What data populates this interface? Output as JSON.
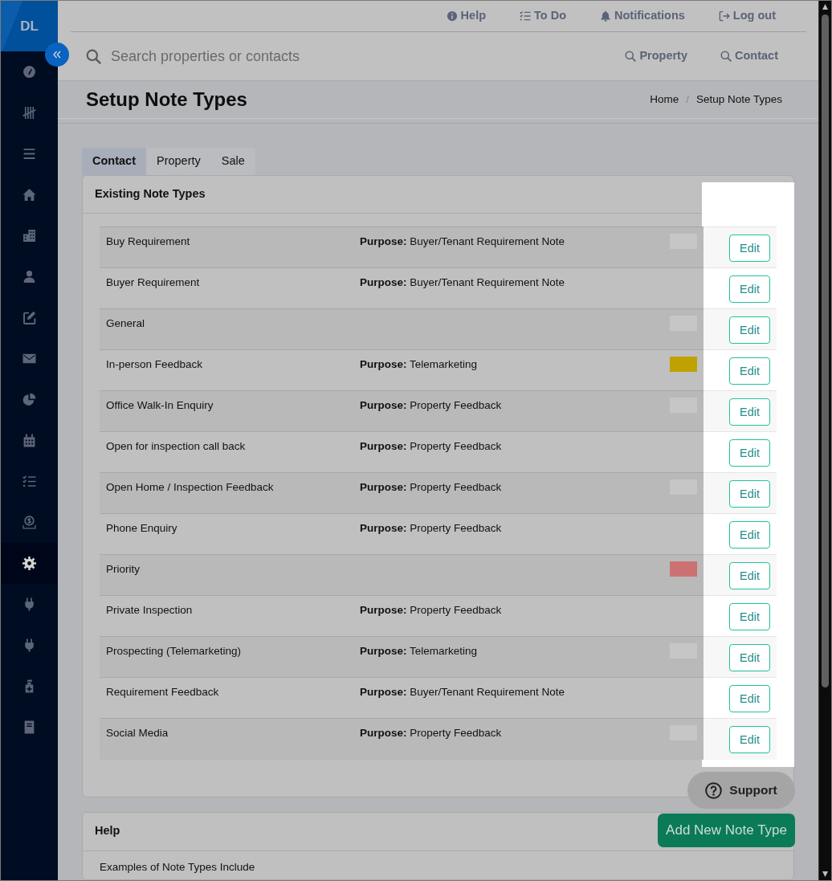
{
  "sidebar": {
    "logo": "DL",
    "items": [
      {
        "selected": false
      },
      {
        "selected": false
      },
      {
        "selected": false
      },
      {
        "selected": false
      },
      {
        "selected": false
      },
      {
        "selected": false
      },
      {
        "selected": false
      },
      {
        "selected": false
      },
      {
        "selected": false
      },
      {
        "selected": false
      },
      {
        "selected": false
      },
      {
        "selected": false
      },
      {
        "selected": true
      },
      {
        "selected": false
      },
      {
        "selected": false
      },
      {
        "selected": false
      },
      {
        "selected": false
      }
    ]
  },
  "top_links": [
    {
      "label": "Help"
    },
    {
      "label": "To Do"
    },
    {
      "label": "Notifications"
    },
    {
      "label": "Log out"
    }
  ],
  "search": {
    "placeholder": "Search properties or contacts",
    "scopes": [
      {
        "label": "Property"
      },
      {
        "label": "Contact"
      }
    ]
  },
  "page_header": {
    "title": "Setup Note Types",
    "breadcrumb": [
      {
        "label": "Home"
      },
      {
        "label": "Setup Note Types"
      }
    ],
    "separator": "/"
  },
  "tabs": [
    {
      "label": "Contact",
      "selected": true
    },
    {
      "label": "Property",
      "selected": false
    },
    {
      "label": "Sale",
      "selected": false
    }
  ],
  "note_types": {
    "title": "Existing Note Types",
    "edit_column_highlighted": true,
    "rows": [
      {
        "name": "Buy Requirement",
        "purpose": "**Purpose:** Buyer/Tenant Requirement Note",
        "color": "#c6c6c6",
        "action": "Edit"
      },
      {
        "name": "Buyer Requirement",
        "purpose": "**Purpose:** Buyer/Tenant Requirement Note",
        "action": "Edit"
      },
      {
        "name": "General",
        "color": "#c6c6c6",
        "action": "Edit"
      },
      {
        "name": "In-person Feedback",
        "purpose": "**Purpose:** Telemarketing",
        "color": "#bfa200",
        "action": "Edit"
      },
      {
        "name": "Office Walk-In Enquiry",
        "purpose": "**Purpose:** Property Feedback",
        "color": "#c6c6c6",
        "action": "Edit"
      },
      {
        "name": "Open for inspection call back",
        "purpose": "**Purpose:** Property Feedback",
        "action": "Edit"
      },
      {
        "name": "Open Home / Inspection Feedback",
        "purpose": "**Purpose:** Property Feedback",
        "color": "#c6c6c6",
        "action": "Edit"
      },
      {
        "name": "Phone Enquiry",
        "purpose": "**Purpose:** Property Feedback",
        "action": "Edit"
      },
      {
        "name": "Priority",
        "color": "#cc7272",
        "action": "Edit"
      },
      {
        "name": "Private Inspection",
        "purpose": "**Purpose:** Property Feedback",
        "action": "Edit"
      },
      {
        "name": "Prospecting (Telemarketing)",
        "purpose": "**Purpose:** Telemarketing",
        "color": "#c6c6c6",
        "action": "Edit"
      },
      {
        "name": "Requirement Feedback",
        "purpose": "**Purpose:** Buyer/Tenant Requirement Note",
        "action": "Edit"
      },
      {
        "name": "Social Media",
        "purpose": "**Purpose:** Property Feedback",
        "color": "#c6c6c6",
        "action": "Edit"
      }
    ]
  },
  "support_button": "Support",
  "add_button": "Add New Note Type",
  "help_card": {
    "title": "Help",
    "text": "Examples of Note Types Include"
  }
}
